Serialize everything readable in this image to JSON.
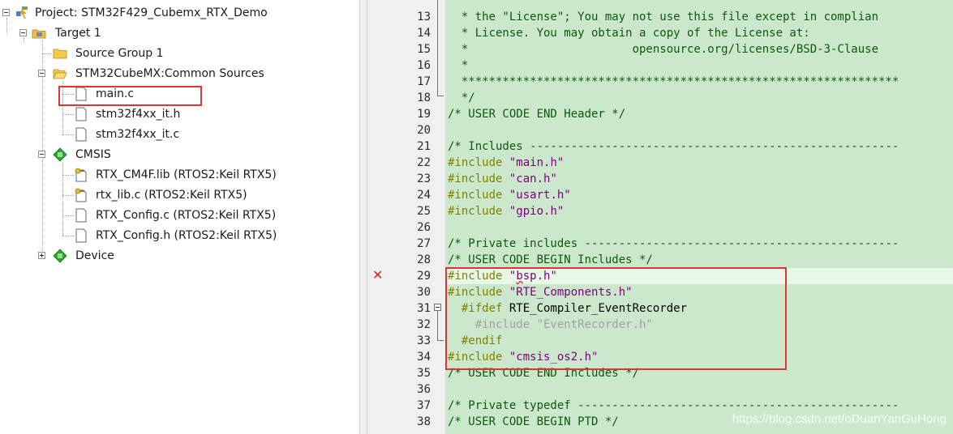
{
  "project_tree": {
    "project": "Project: STM32F429_Cubemx_RTX_Demo",
    "target": "Target 1",
    "source_group": "Source Group 1",
    "common_sources": "STM32CubeMX:Common Sources",
    "files": {
      "main_c": "main.c",
      "it_h": "stm32f4xx_it.h",
      "it_c": "stm32f4xx_it.c"
    },
    "cmsis": "CMSIS",
    "cmsis_files": {
      "rtx_lib_a": "RTX_CM4F.lib (RTOS2:Keil RTX5)",
      "rtx_lib_c": "rtx_lib.c (RTOS2:Keil RTX5)",
      "rtx_config_c": "RTX_Config.c (RTOS2:Keil RTX5)",
      "rtx_config_h": "RTX_Config.h (RTOS2:Keil RTX5)"
    },
    "device": "Device"
  },
  "editor": {
    "line_numbers": [
      "13",
      "14",
      "15",
      "16",
      "17",
      "18",
      "19",
      "20",
      "21",
      "22",
      "23",
      "24",
      "25",
      "26",
      "27",
      "28",
      "29",
      "30",
      "31",
      "32",
      "33",
      "34",
      "35",
      "36",
      "37",
      "38"
    ],
    "lines": {
      "l13": "  * the \"License\"; You may not use this file except in complian",
      "l14": "  * License. You may obtain a copy of the License at:",
      "l15": "  *                        opensource.org/licenses/BSD-3-Clause",
      "l16": "  *",
      "l17": "  ****************************************************************",
      "l18": "  */",
      "l19": "/* USER CODE END Header */",
      "l21": "/* Includes ------------------------------------------------------",
      "inc": "#include",
      "s22": "\"main.h\"",
      "s23": "\"can.h\"",
      "s24": "\"usart.h\"",
      "s25": "\"gpio.h\"",
      "l27": "/* Private includes ----------------------------------------------",
      "l28": "/* USER CODE BEGIN Includes */",
      "s29a": "\"",
      "s29b": "b",
      "s29c": "sp.h\"",
      "s30": "\"RTE_Components.h\"",
      "ifdef": "#ifdef",
      "ifdef_sym": "RTE_Compiler_EventRecorder",
      "l32": "    #include \"EventRecorder.h\"",
      "endif": "#endif",
      "s34": "\"cmsis_os2.h\"",
      "l35": "/* USER CODE END Includes */",
      "l37": "/* Private typedef -----------------------------------------------",
      "l38": "/* USER CODE BEGIN PTD */"
    },
    "error_marker": "✕",
    "watermark": "https://blog.csdn.net/oDuanYanGuHong"
  }
}
